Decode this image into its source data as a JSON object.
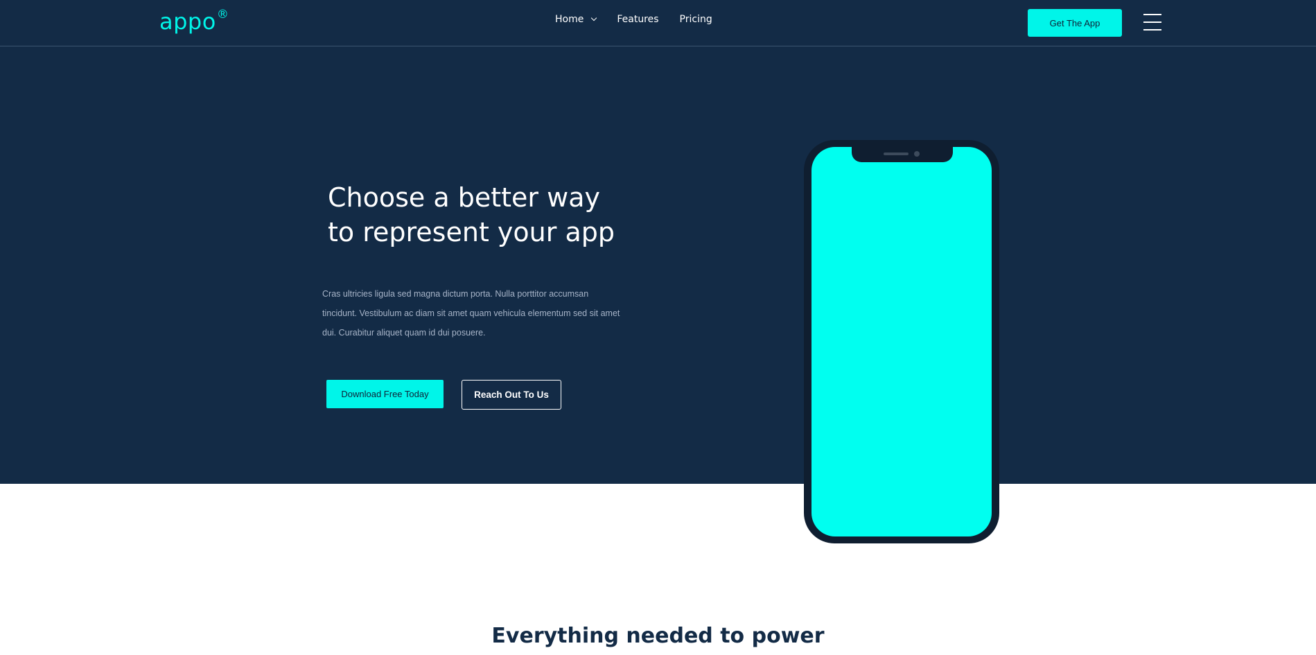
{
  "brand": {
    "name": "appo",
    "mark": "®"
  },
  "nav": {
    "items": [
      {
        "label": "Home",
        "has_dropdown": true
      },
      {
        "label": "Features",
        "has_dropdown": false
      },
      {
        "label": "Pricing",
        "has_dropdown": false
      }
    ],
    "cta_label": "Get The App",
    "menu_icon": "hamburger-icon"
  },
  "hero": {
    "title": "Choose a better way to represent your app",
    "text": "Cras ultricies ligula sed magna dictum porta. Nulla porttitor accumsan tincidunt. Vestibulum ac diam sit amet quam vehicula elementum sed sit amet dui. Curabitur aliquet quam id dui posuere.",
    "primary_button": "Download Free Today",
    "secondary_button": "Reach Out To Us"
  },
  "section": {
    "title": "Everything needed to power"
  },
  "colors": {
    "navy": "#132b46",
    "accent": "#00f5e9",
    "phone_screen": "#00fff0",
    "phone_body": "#0f1e30"
  }
}
